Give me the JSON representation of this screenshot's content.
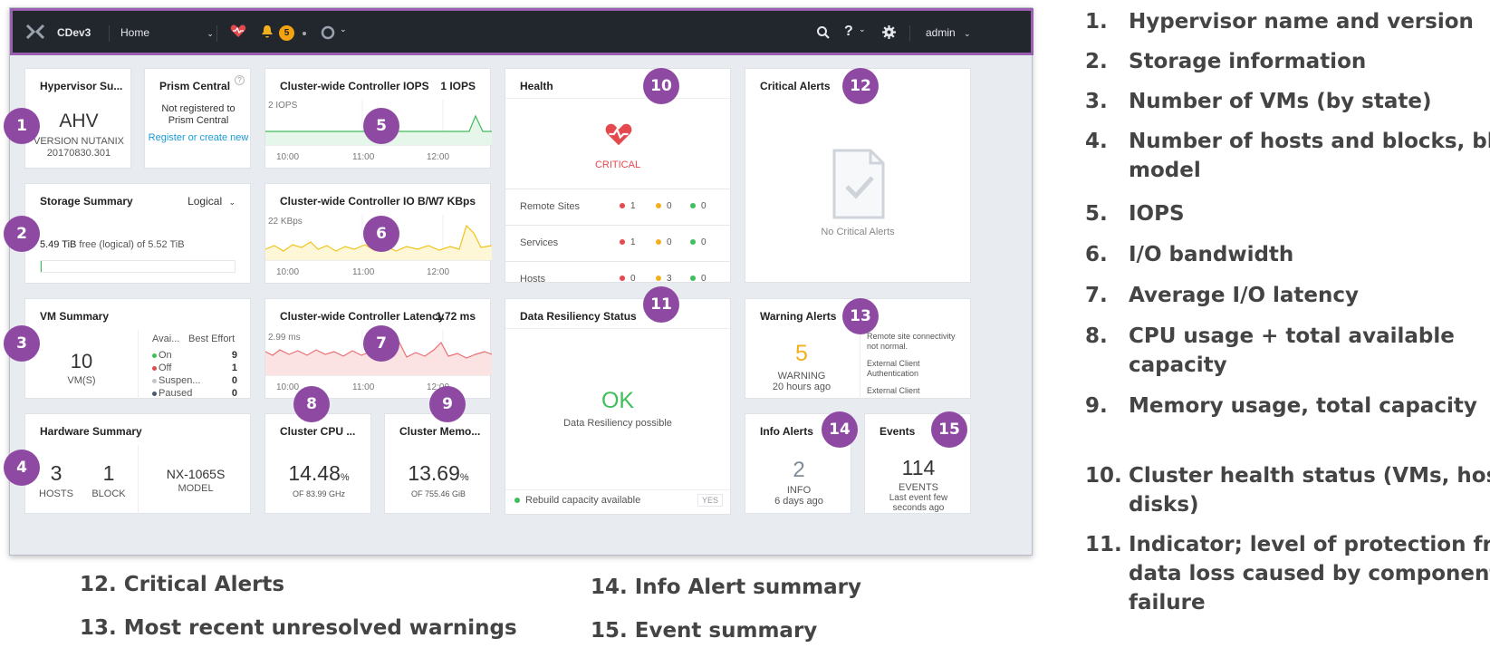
{
  "topbar": {
    "cluster": "CDev3",
    "view": "Home",
    "alerts_count": "5",
    "user": "admin"
  },
  "cards": {
    "hypervisor": {
      "title": "Hypervisor Su...",
      "name": "AHV",
      "version": "VERSION NUTANIX 20170830.301"
    },
    "prism": {
      "title": "Prism Central",
      "status": "Not registered to Prism Central",
      "link": "Register or create new"
    },
    "iops": {
      "title": "Cluster-wide Controller IOPS",
      "value": "1 IOPS",
      "peak": "2 IOPS",
      "times": [
        "10:00",
        "11:00",
        "12:00"
      ]
    },
    "health": {
      "title": "Health",
      "status": "CRITICAL",
      "rows": [
        {
          "label": "Remote Sites",
          "red": "1",
          "yellow": "0",
          "green": "0"
        },
        {
          "label": "Services",
          "red": "1",
          "yellow": "0",
          "green": "0"
        },
        {
          "label": "Hosts",
          "red": "0",
          "yellow": "3",
          "green": "0"
        }
      ]
    },
    "critical": {
      "title": "Critical Alerts",
      "empty": "No Critical Alerts"
    },
    "storage": {
      "title": "Storage Summary",
      "mode": "Logical",
      "free": "5.49 TiB",
      "free_text": "free (logical) of 5.52 TiB"
    },
    "iobw": {
      "title": "Cluster-wide Controller IO B/W",
      "value": "7 KBps",
      "peak": "22 KBps",
      "times": [
        "10:00",
        "11:00",
        "12:00"
      ]
    },
    "vm": {
      "title": "VM Summary",
      "count": "10",
      "unit": "VM(S)",
      "col1": "Avai...",
      "col2": "Best Effort",
      "states": [
        {
          "label": "On",
          "value": "9"
        },
        {
          "label": "Off",
          "value": "1"
        },
        {
          "label": "Suspen...",
          "value": "0"
        },
        {
          "label": "Paused",
          "value": "0"
        }
      ]
    },
    "latency": {
      "title": "Cluster-wide Controller Latency",
      "value": "1.72 ms",
      "peak": "2.99 ms",
      "times": [
        "10:00",
        "11:00",
        "12:00"
      ]
    },
    "resiliency": {
      "title": "Data Resiliency Status",
      "status": "OK",
      "desc": "Data Resiliency possible",
      "footer": "Rebuild capacity available",
      "footer_tag": "YES"
    },
    "warning": {
      "title": "Warning Alerts",
      "count": "5",
      "label": "WARNING",
      "time": "20 hours ago",
      "items": [
        "Remote site connectivity not normal.",
        "External Client Authentication",
        "External Client"
      ]
    },
    "hardware": {
      "title": "Hardware Summary",
      "hosts": "3",
      "hosts_label": "HOSTS",
      "blocks": "1",
      "blocks_label": "BLOCK",
      "model": "NX-1065S",
      "model_label": "MODEL"
    },
    "cpu": {
      "title": "Cluster CPU ...",
      "value": "14.48",
      "unit": "%",
      "of": "OF 83.99 GHz"
    },
    "memory": {
      "title": "Cluster Memo...",
      "value": "13.69",
      "unit": "%",
      "of": "OF 755.46 GiB"
    },
    "info": {
      "title": "Info Alerts",
      "count": "2",
      "label": "INFO",
      "time": "6 days ago"
    },
    "events": {
      "title": "Events",
      "count": "114",
      "label": "EVENTS",
      "time": "Last event few seconds ago"
    }
  },
  "legend_right": [
    {
      "n": "1.",
      "t": "Hypervisor name and version"
    },
    {
      "n": "2.",
      "t": "Storage information"
    },
    {
      "n": "3.",
      "t": "Number of VMs (by state)"
    },
    {
      "n": "4.",
      "t": "Number of hosts and blocks, block"
    },
    {
      "n": "",
      "t": "model"
    },
    {
      "n": "5.",
      "t": "IOPS"
    },
    {
      "n": "6.",
      "t": "I/O bandwidth"
    },
    {
      "n": "7.",
      "t": "Average I/O latency"
    },
    {
      "n": "8.",
      "t": "CPU usage + total available"
    },
    {
      "n": "",
      "t": "capacity"
    },
    {
      "n": "9.",
      "t": "Memory usage, total capacity"
    },
    {
      "n": "10.",
      "t": "Cluster health status (VMs, hosts &"
    },
    {
      "n": "",
      "t": "disks)"
    },
    {
      "n": "11.",
      "t": "Indicator; level of protection from"
    },
    {
      "n": "",
      "t": "data loss caused by component"
    },
    {
      "n": "",
      "t": "failure"
    }
  ],
  "legend_bottom": [
    "12. Critical Alerts",
    "13. Most recent unresolved warnings",
    "14. Info Alert summary",
    "15. Event summary"
  ],
  "badges": [
    "1",
    "2",
    "3",
    "4",
    "5",
    "6",
    "7",
    "8",
    "9",
    "10",
    "11",
    "12",
    "13",
    "14",
    "15"
  ]
}
